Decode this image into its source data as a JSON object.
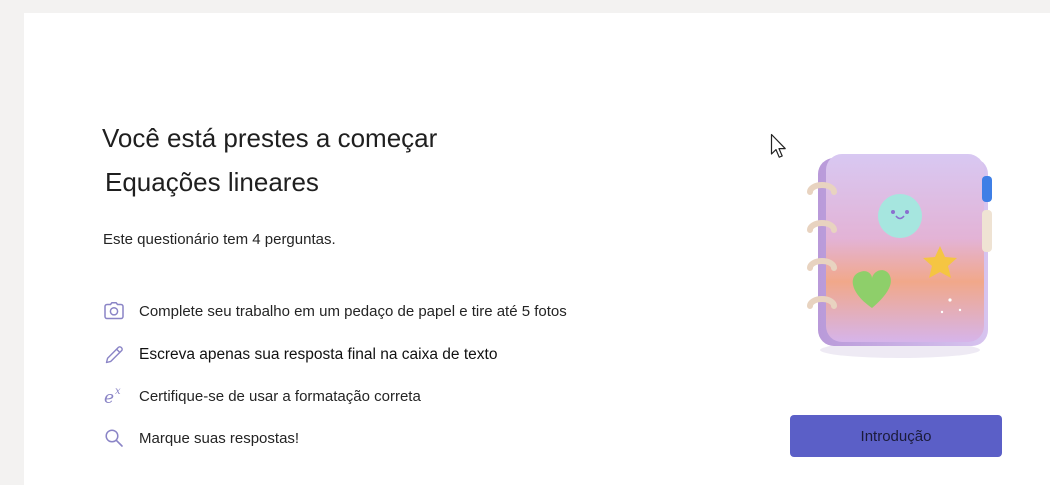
{
  "intro": {
    "title": "Você está prestes a começar",
    "assignment_name": "Equações lineares",
    "question_count_text": "Este questionário tem 4 perguntas."
  },
  "instructions": [
    {
      "icon": "camera-icon",
      "text": "Complete seu trabalho em um pedaço de papel e tire até 5 fotos"
    },
    {
      "icon": "pencil-icon",
      "text": "Escreva apenas sua resposta final na caixa de texto"
    },
    {
      "icon": "math-exponent-icon",
      "text": "Certifique-se de usar a formatação correta"
    },
    {
      "icon": "search-icon",
      "text": "Marque suas respostas!"
    }
  ],
  "actions": {
    "start_label": "Introdução"
  },
  "colors": {
    "accent": "#5b5fc7",
    "icon": "#8a84c6",
    "background": "#f3f2f1",
    "card": "#ffffff"
  }
}
